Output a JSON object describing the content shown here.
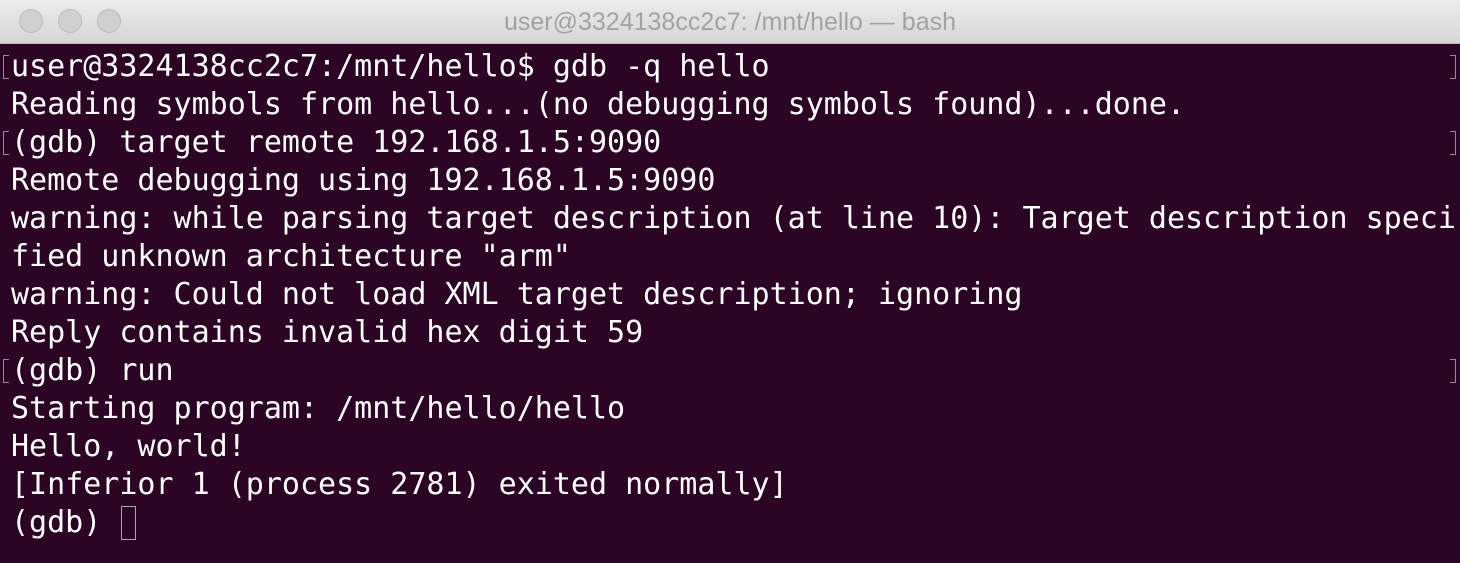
{
  "window": {
    "title": "user@3324138cc2c7: /mnt/hello — bash"
  },
  "terminal": {
    "lines": [
      "user@3324138cc2c7:/mnt/hello$ gdb -q hello",
      "Reading symbols from hello...(no debugging symbols found)...done.",
      "(gdb) target remote 192.168.1.5:9090",
      "Remote debugging using 192.168.1.5:9090",
      "warning: while parsing target description (at line 10): Target description speci",
      "fied unknown architecture \"arm\"",
      "warning: Could not load XML target description; ignoring",
      "Reply contains invalid hex digit 59",
      "(gdb) run",
      "Starting program: /mnt/hello/hello",
      "Hello, world!",
      "[Inferior 1 (process 2781) exited normally]"
    ],
    "prompt": "(gdb) "
  },
  "colors": {
    "background": "#2c0525",
    "foreground": "#ffffff",
    "titlebar": "#e3e3e3"
  }
}
